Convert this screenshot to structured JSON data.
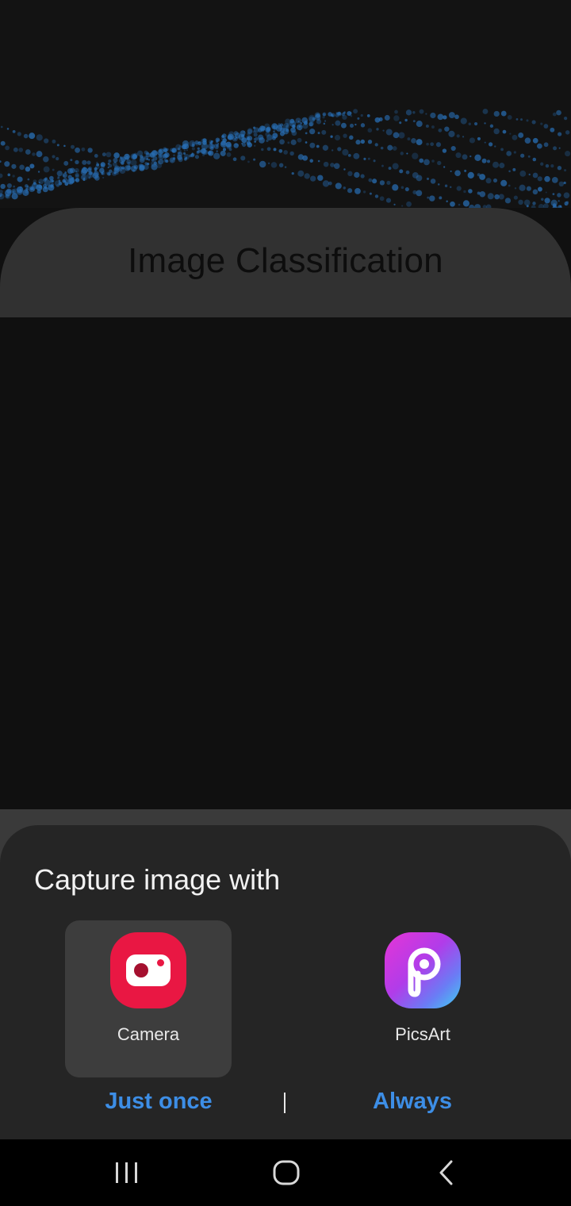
{
  "app": {
    "title": "Image Classification"
  },
  "chooser": {
    "title": "Capture image with",
    "apps": [
      {
        "label": "Camera",
        "icon": "camera-icon",
        "selected": true
      },
      {
        "label": "PicsArt",
        "icon": "picsart-icon",
        "selected": false
      }
    ],
    "just_once_label": "Just once",
    "always_label": "Always"
  },
  "navbar": {
    "items": [
      "recent-apps-icon",
      "home-icon",
      "back-icon"
    ]
  },
  "colors": {
    "accent": "#3d8ee6",
    "camera_icon": "#e91743",
    "sheet_background": "#252525"
  }
}
